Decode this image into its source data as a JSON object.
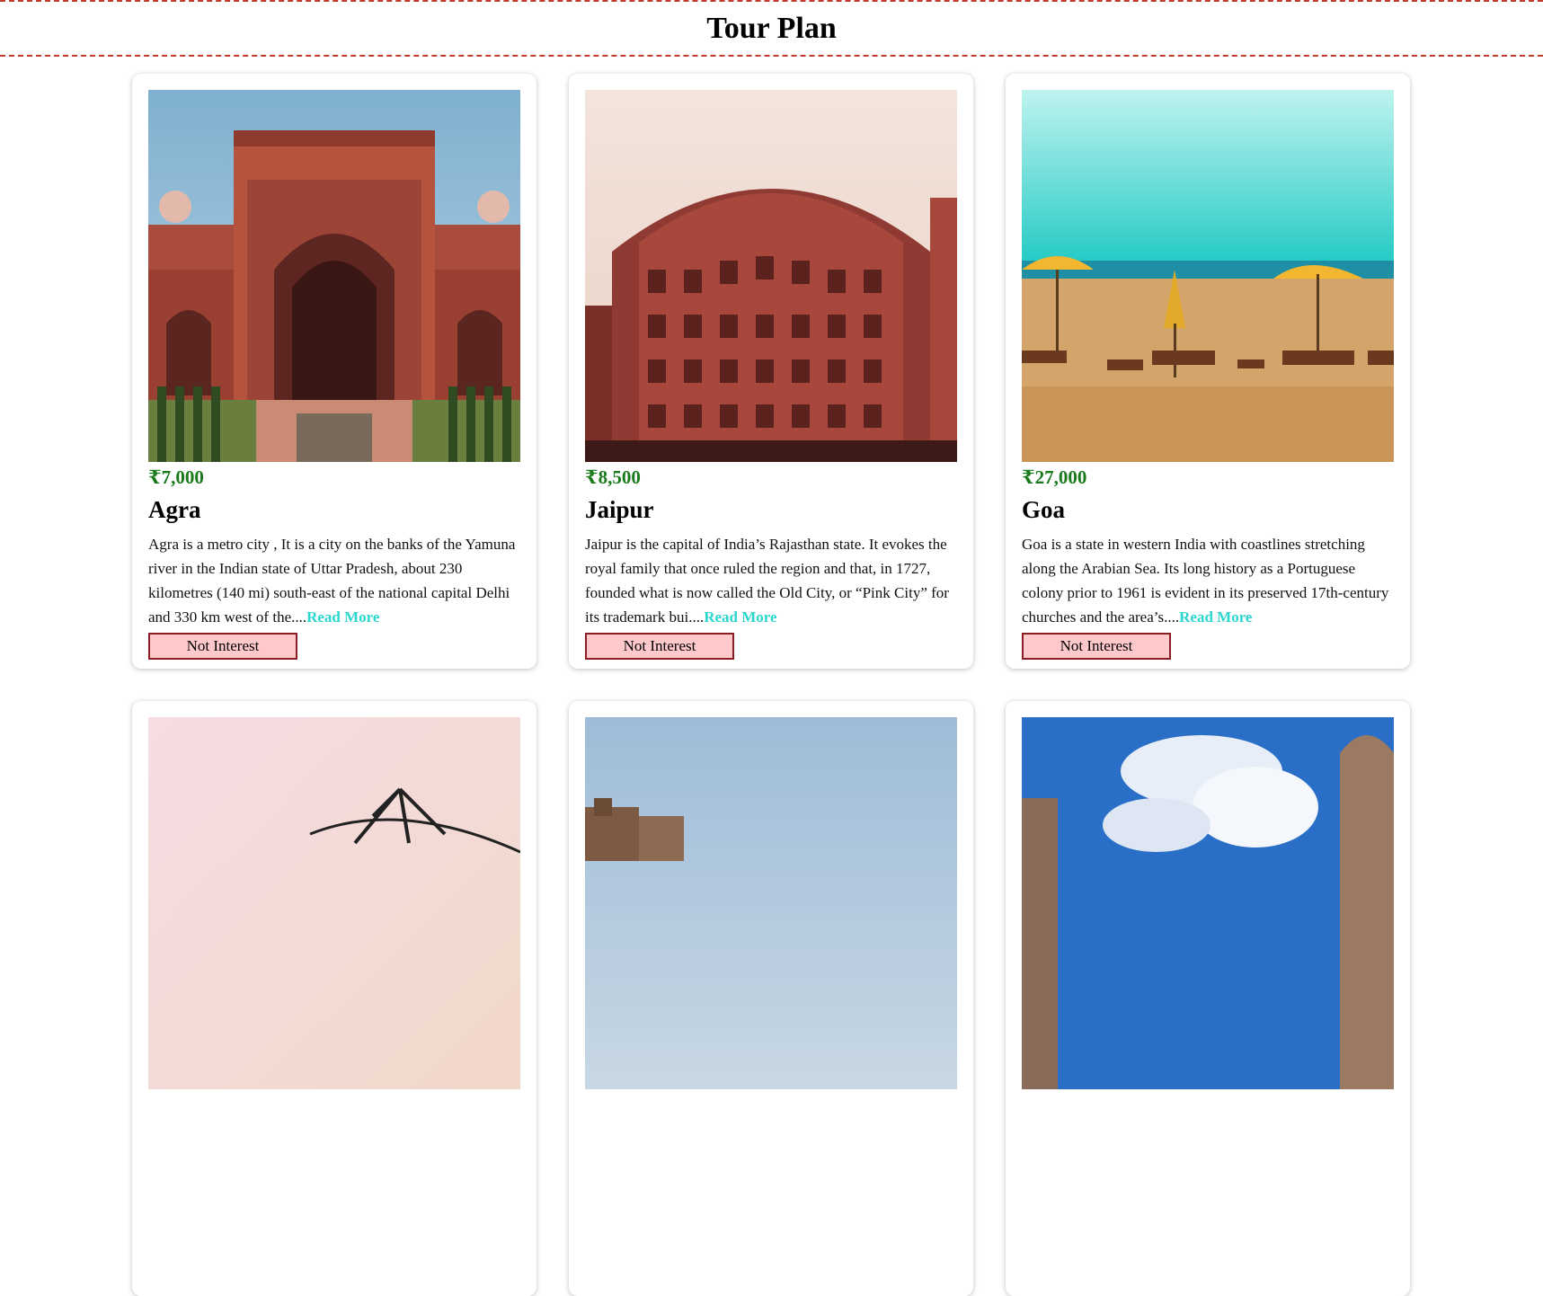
{
  "page": {
    "title": "Tour Plan"
  },
  "cards": [
    {
      "price": "₹7,000",
      "name": "Agra",
      "description": "Agra is a metro city , It is a city on the banks of the Yamuna river in the Indian state of Uttar Pradesh, about 230 kilometres (140 mi) south-east of the national capital Delhi and 330 km west of the....",
      "read_more": "Read More",
      "button": "Not Interest"
    },
    {
      "price": "₹8,500",
      "name": "Jaipur",
      "description": "Jaipur is the capital of India’s Rajasthan state. It evokes the royal family that once ruled the region and that, in 1727, founded what is now called the Old City, or “Pink City” for its trademark bui....",
      "read_more": "Read More",
      "button": "Not Interest"
    },
    {
      "price": "₹27,000",
      "name": "Goa",
      "description": "Goa is a state in western India with coastlines stretching along the Arabian Sea. Its long history as a Portuguese colony prior to 1961 is evident in its preserved 17th-century churches and the area’s....",
      "read_more": "Read More",
      "button": "Not Interest"
    }
  ],
  "colors": {
    "price": "#1b7a1b",
    "read_more": "#2bd6cf",
    "button_bg": "#ffc9cc",
    "button_border": "#8b1e25",
    "title_border": "#c0392b"
  }
}
